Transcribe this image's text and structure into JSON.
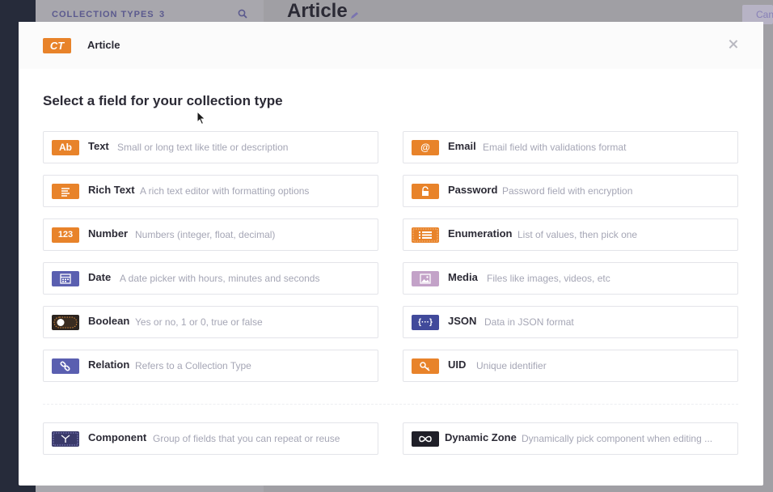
{
  "background": {
    "sidebar_heading": "COLLECTION TYPES",
    "sidebar_count": "3",
    "page_title": "Article",
    "button_partial": "Can"
  },
  "modal": {
    "badge": "CT",
    "name": "Article",
    "section_title": "Select a field for your collection type"
  },
  "fields": [
    {
      "label": "Text",
      "description": "Small or long text like title or description",
      "icon": "Ab",
      "color": "#e8832a"
    },
    {
      "label": "Email",
      "description": "Email field with validations format",
      "icon": "@",
      "color": "#e8832a"
    },
    {
      "label": "Rich Text",
      "description": "A rich text editor with formatting options",
      "icon": "align-left-icon",
      "color": "#e8832a"
    },
    {
      "label": "Password",
      "description": "Password field with encryption",
      "icon": "lock-icon",
      "color": "#e8832a"
    },
    {
      "label": "Number",
      "description": "Numbers (integer, float, decimal)",
      "icon": "123",
      "color": "#e8832a"
    },
    {
      "label": "Enumeration",
      "description": "List of values, then pick one",
      "icon": "list-icon",
      "color": "#e8832a"
    },
    {
      "label": "Date",
      "description": "A date picker with hours, minutes and seconds",
      "icon": "calendar-icon",
      "color": "#5a5fb0"
    },
    {
      "label": "Media",
      "description": "Files like images, videos, etc",
      "icon": "image-icon",
      "color": "#c3a2c8"
    },
    {
      "label": "Boolean",
      "description": "Yes or no, 1 or 0, true or false",
      "icon": "toggle-icon",
      "color": "#2b2420"
    },
    {
      "label": "JSON",
      "description": "Data in JSON format",
      "icon": "{···}",
      "color": "#414a9b"
    },
    {
      "label": "Relation",
      "description": "Refers to a Collection Type",
      "icon": "link-icon",
      "color": "#5a5fb0"
    },
    {
      "label": "UID",
      "description": "Unique identifier",
      "icon": "key-icon",
      "color": "#e8832a"
    },
    {
      "label": "Component",
      "description": "Group of fields that you can repeat or reuse",
      "icon": "component-icon",
      "color": "#3a3a6a"
    },
    {
      "label": "Dynamic Zone",
      "description": "Dynamically pick component when editing ...",
      "icon": "infinity-icon",
      "color": "#1f1f28"
    }
  ]
}
